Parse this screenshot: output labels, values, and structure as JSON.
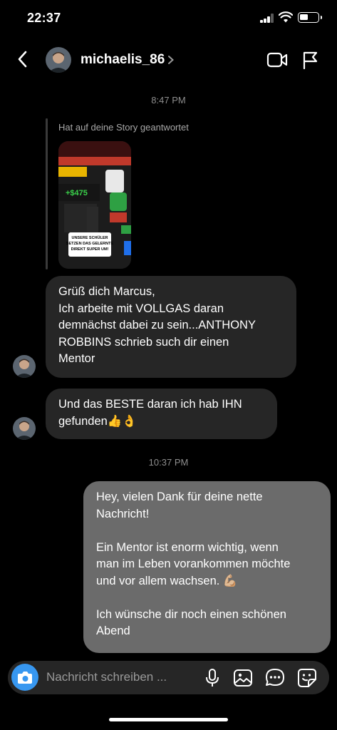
{
  "status_bar": {
    "time": "22:37"
  },
  "header": {
    "username": "michaelis_86"
  },
  "thread": {
    "timestamps": [
      "8:47 PM",
      "10:37 PM"
    ],
    "story_reply": {
      "caption": "Hat auf deine Story geantwortet",
      "thumb_text": [
        "UNSERE SCHÜLER",
        "SETZEN DAS GELERNTE",
        "DIREKT SUPER UM!"
      ]
    },
    "messages": [
      {
        "from": "michaelis_86",
        "lines": [
          "Grüß dich Marcus,",
          "Ich arbeite mit VOLLGAS daran",
          "demnächst dabei zu sein...ANTHONY",
          "ROBBINS schrieb such dir einen",
          "Mentor"
        ]
      },
      {
        "from": "michaelis_86",
        "lines": [
          "Und das BESTE daran ich hab IHN",
          "gefunden👍👌"
        ]
      },
      {
        "from": "me",
        "lines": [
          "Hey, vielen Dank für deine nette",
          "Nachricht!",
          "",
          "Ein Mentor ist enorm wichtig, wenn",
          "man im Leben vorankommen möchte",
          "und vor allem wachsen. 💪🏼",
          "",
          "Ich wünsche dir noch einen schönen",
          "Abend"
        ]
      }
    ]
  },
  "composer": {
    "placeholder": "Nachricht schreiben ..."
  },
  "colors": {
    "background": "#000000",
    "incoming_bubble": "#262626",
    "outgoing_bubble": "#6b6b6b",
    "camera_button": "#3797f0"
  }
}
